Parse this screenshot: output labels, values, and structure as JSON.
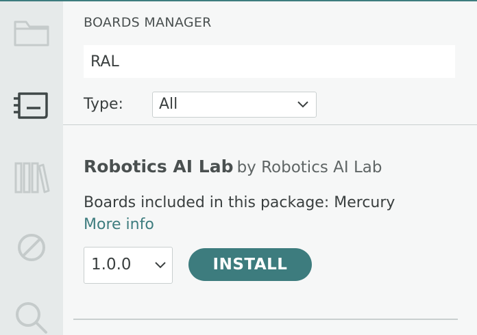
{
  "colors": {
    "accent": "#3d7c7e",
    "activity_bar": "#e6eaea",
    "icon_inactive": "#c5cbcb",
    "icon_active": "#3f4747"
  },
  "activity_bar": {
    "icons": [
      {
        "icon": "folder-icon",
        "active": false
      },
      {
        "icon": "board-icon",
        "active": true
      },
      {
        "icon": "library-icon",
        "active": false
      },
      {
        "icon": "debug-icon",
        "active": false
      },
      {
        "icon": "search-icon",
        "active": false
      }
    ]
  },
  "boards_manager": {
    "title": "BOARDS MANAGER",
    "search": {
      "value": "RAL",
      "placeholder": ""
    },
    "type_filter": {
      "label": "Type:",
      "selected": "All"
    },
    "results": [
      {
        "name": "Robotics AI Lab",
        "by_text": "by Robotics AI Lab",
        "description": "Boards included in this package: Mercury",
        "more_info_label": "More info",
        "version": "1.0.0",
        "install_label": "INSTALL"
      }
    ]
  }
}
